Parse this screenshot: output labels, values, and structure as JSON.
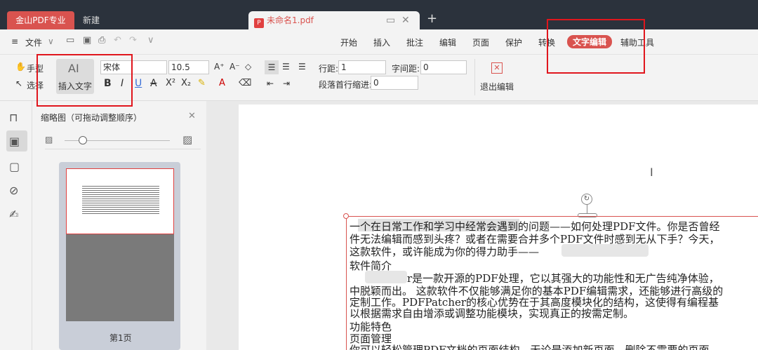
{
  "titlebar": {
    "brand_tab": "金山PDF专业版",
    "new_tab": "新建",
    "doc_tab": "未命名1.pdf",
    "pdf_badge": "P"
  },
  "menubar": {
    "file_label": "文件",
    "menus": [
      "开始",
      "插入",
      "批注",
      "编辑",
      "页面",
      "保护",
      "转换",
      "文字编辑",
      "辅助工具"
    ],
    "active_menu": "文字编辑"
  },
  "toolbar": {
    "hand_tool": "手型",
    "select_tool": "选择",
    "insert_text_icon": "AI",
    "insert_text": "插入文字",
    "font_name": "宋体",
    "font_size": "10.5",
    "line_spacing_label": "行距:",
    "line_spacing_value": "1",
    "char_spacing_label": "字间距:",
    "char_spacing_value": "0",
    "first_indent_label": "段落首行缩进:",
    "first_indent_value": "0",
    "exit_edit": "退出编辑"
  },
  "thumbnails": {
    "title": "缩略图（可拖动调整顺序）",
    "page_label": "第1页"
  },
  "document": {
    "lines": [
      "一个在日常工作和学习中经常会遇到的问题——如何处理PDF文件。你是否曾经",
      "件无法编辑而感到头疼？或者在需要合并多个PDF文件时感到无从下手？今天，",
      "这款软件，或许能成为你的得力助手——",
      "软件简介",
      "r是一款开源的PDF处理，它以其强大的功能性和无广告纯净体验，",
      "中脱颖而出。 这款软件不仅能够满足你的基本PDF编辑需求，还能够进行高级的",
      "定制工作。PDFPatcher的核心优势在于其高度模块化的结构，这使得有编程基",
      "以根据需求自由增添或调整功能模块，实现真正的按需定制。",
      "功能特色",
      "页面管理",
      "你可以轻松管理PDF文档的页面结构，无论是添加新页面、删除不需要的页面，"
    ]
  },
  "colors": {
    "accent_red": "#d9534f",
    "highlight_red": "#e0161d"
  }
}
